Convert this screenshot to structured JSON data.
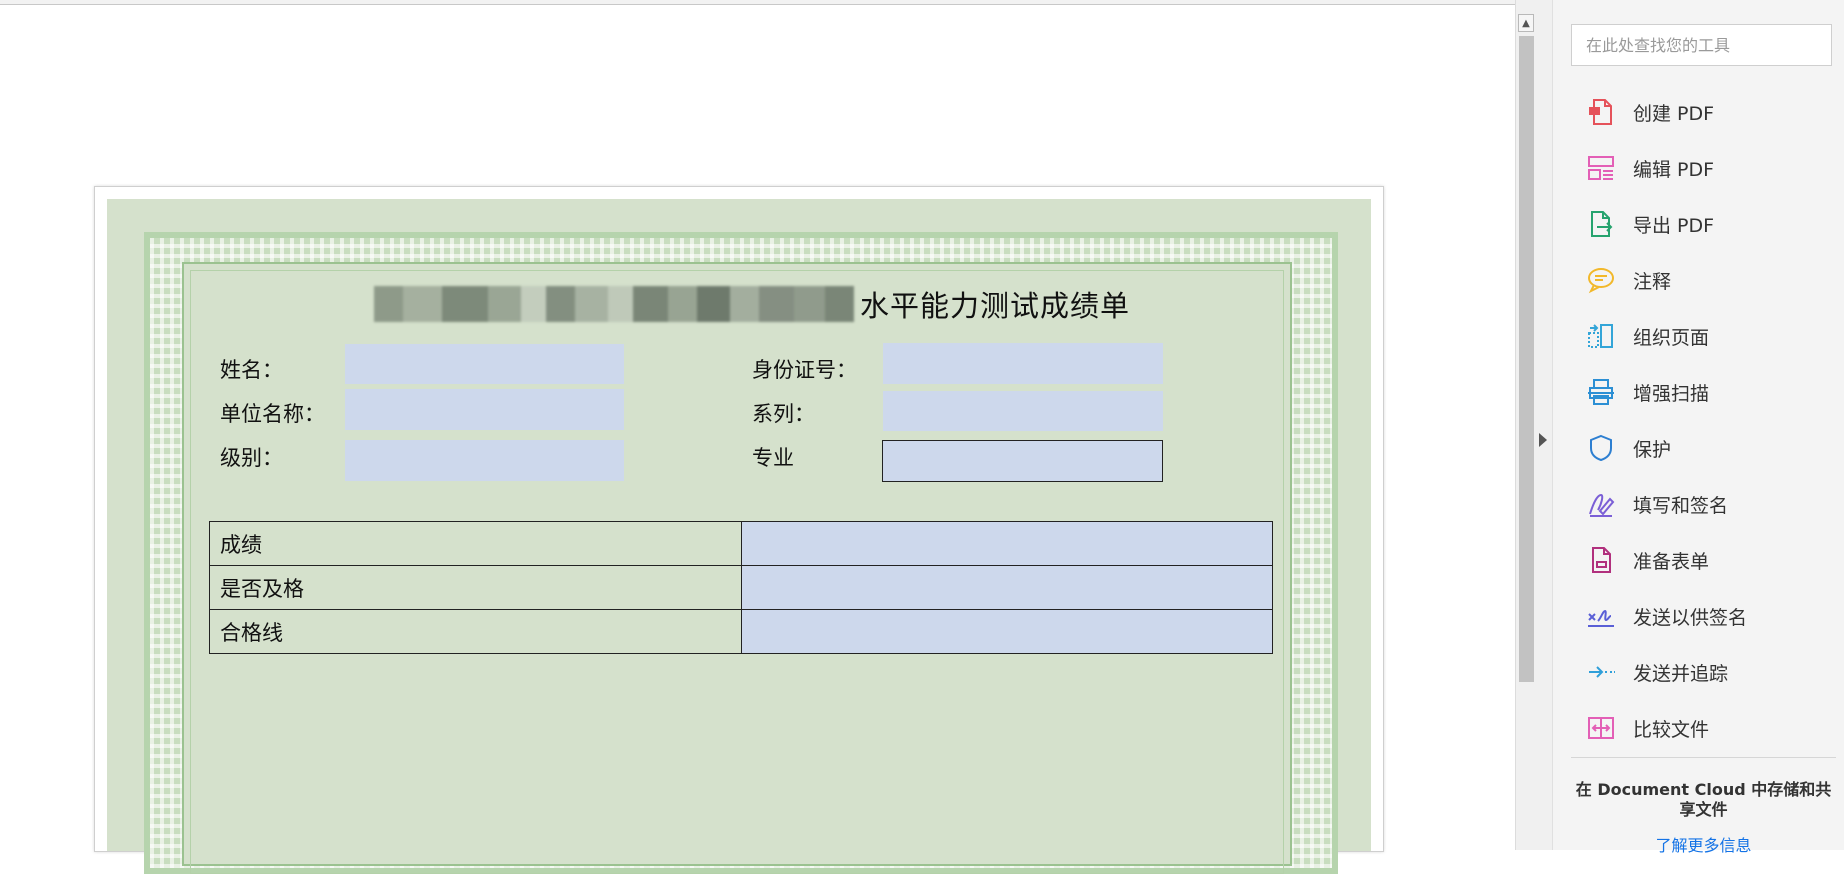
{
  "certificate": {
    "title_suffix": "水平能力测试成绩单",
    "fields_left": [
      {
        "label": "姓名：",
        "value": ""
      },
      {
        "label": "单位名称：",
        "value": ""
      },
      {
        "label": "级别：",
        "value": ""
      }
    ],
    "fields_right": [
      {
        "label": "身份证号：",
        "value": ""
      },
      {
        "label": "系列：",
        "value": ""
      },
      {
        "label": "专业",
        "value": ""
      }
    ],
    "score_rows": [
      {
        "label": "成绩",
        "value": ""
      },
      {
        "label": "是否及格",
        "value": ""
      },
      {
        "label": "合格线",
        "value": ""
      }
    ],
    "colors": {
      "background": "#d5e1cc",
      "field": "#cdd8ec",
      "border_green": "#b6d4ad"
    }
  },
  "tools_panel": {
    "search_placeholder": "在此处查找您的工具",
    "items": [
      {
        "label": "创建 PDF",
        "icon": "create-pdf-icon",
        "color": "#e5525a"
      },
      {
        "label": "编辑 PDF",
        "icon": "edit-pdf-icon",
        "color": "#e35fb6"
      },
      {
        "label": "导出 PDF",
        "icon": "export-pdf-icon",
        "color": "#26a36e"
      },
      {
        "label": "注释",
        "icon": "comment-icon",
        "color": "#f2b82a"
      },
      {
        "label": "组织页面",
        "icon": "organize-pages-icon",
        "color": "#33a5d8"
      },
      {
        "label": "增强扫描",
        "icon": "enhance-scan-icon",
        "color": "#2c8fd4"
      },
      {
        "label": "保护",
        "icon": "protect-icon",
        "color": "#2d7fd1"
      },
      {
        "label": "填写和签名",
        "icon": "fill-sign-icon",
        "color": "#7b5fd6"
      },
      {
        "label": "准备表单",
        "icon": "prepare-form-icon",
        "color": "#b1307d"
      },
      {
        "label": "发送以供签名",
        "icon": "send-for-signature-icon",
        "color": "#5a5fd6"
      },
      {
        "label": "发送并追踪",
        "icon": "send-track-icon",
        "color": "#2f9fd9"
      },
      {
        "label": "比较文件",
        "icon": "compare-files-icon",
        "color": "#e35fb6"
      }
    ],
    "cloud_text": "在 Document Cloud 中存储和共享文件",
    "learn_more": "了解更多信息"
  }
}
